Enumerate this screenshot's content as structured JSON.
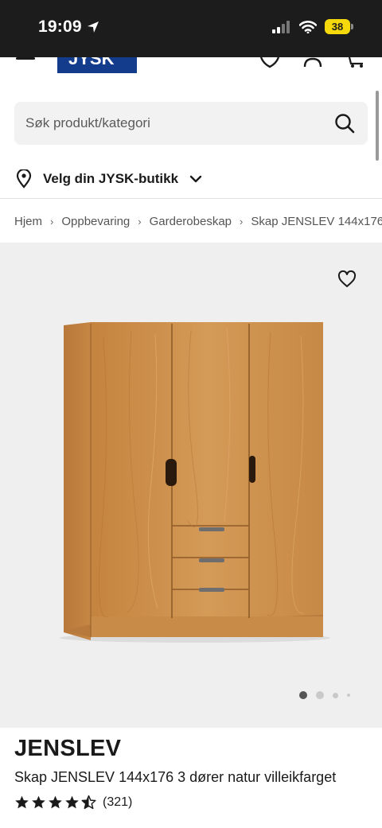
{
  "status_bar": {
    "time": "19:09",
    "battery": "38"
  },
  "header": {
    "logo_text": "JYSK"
  },
  "search": {
    "placeholder": "Søk produkt/kategori"
  },
  "store_selector": {
    "label": "Velg din JYSK-butikk"
  },
  "breadcrumb": [
    "Hjem",
    "Oppbevaring",
    "Garderobeskap",
    "Skap JENSLEV 144x176"
  ],
  "gallery": {
    "image_count": 4,
    "active_index": 0
  },
  "product": {
    "brand": "JENSLEV",
    "name": "Skap JENSLEV 144x176 3 dører natur villeikfarget",
    "rating": 4.5,
    "review_count": "(321)"
  },
  "colors": {
    "status_bar": "#1c1c1c",
    "brand_blue": "#143c8c",
    "battery": "#f5d90a",
    "wood": "#c98a45"
  }
}
